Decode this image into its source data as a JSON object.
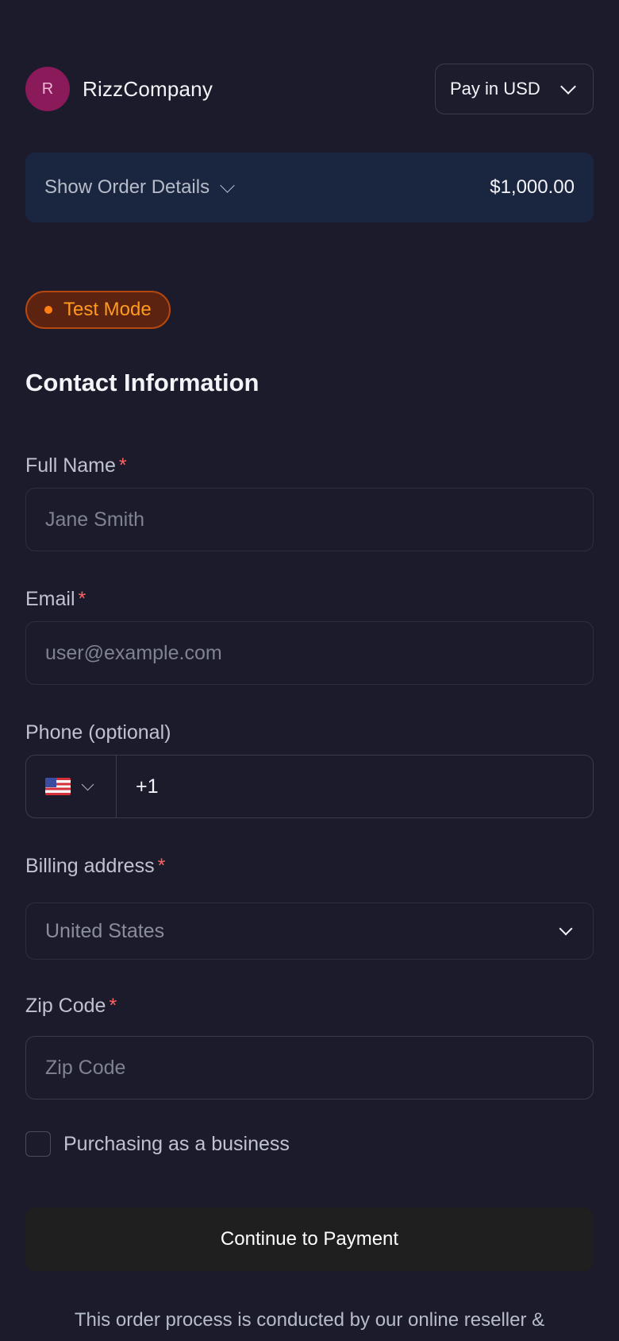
{
  "header": {
    "avatar_letter": "R",
    "brand_name": "RizzCompany",
    "currency_label": "Pay in USD"
  },
  "order": {
    "toggle_label": "Show Order Details",
    "total": "$1,000.00"
  },
  "badge": {
    "label": "Test Mode"
  },
  "contact": {
    "title": "Contact Information",
    "full_name": {
      "label": "Full Name",
      "required_mark": "*",
      "placeholder": "Jane Smith"
    },
    "email": {
      "label": "Email",
      "required_mark": "*",
      "placeholder": "user@example.com"
    },
    "phone": {
      "label": "Phone (optional)",
      "country_icon": "us-flag-icon",
      "value": "+1"
    },
    "billing": {
      "label": "Billing address",
      "required_mark": "*",
      "selected": "United States"
    },
    "zip": {
      "label": "Zip Code",
      "required_mark": "*",
      "placeholder": "Zip Code"
    },
    "business_checkbox": {
      "label": "Purchasing as a business",
      "checked": false
    }
  },
  "cta": {
    "label": "Continue to Payment"
  },
  "footer": {
    "note": "This order process is conducted by our online reseller &"
  },
  "colors": {
    "background": "#1b1b2b",
    "order_bar": "#1a2540",
    "badge_text": "#ff9a1f",
    "required": "#ff6262",
    "avatar": "#8b1a5a"
  }
}
